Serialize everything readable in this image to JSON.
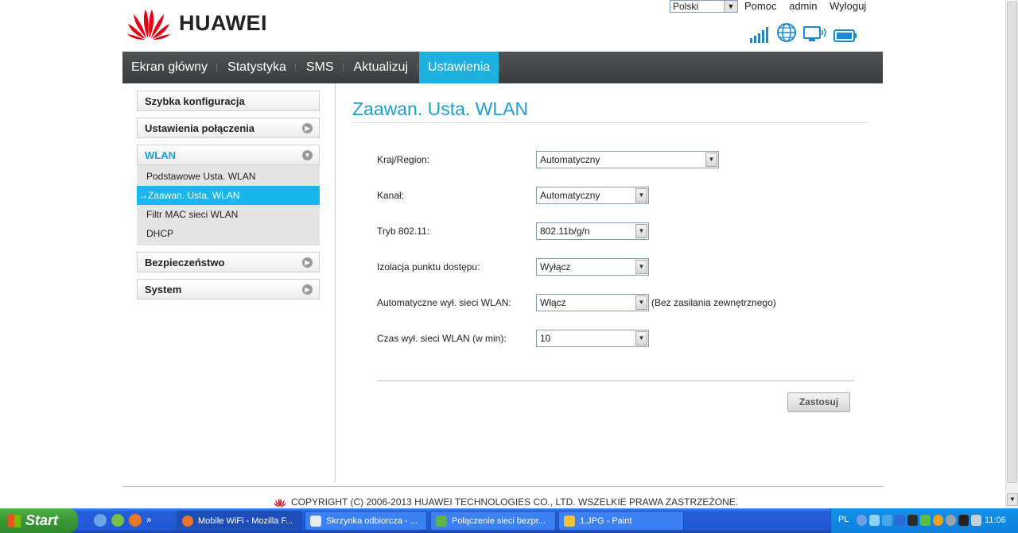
{
  "header": {
    "brand": "HUAWEI",
    "language": "Polski",
    "links": [
      "Pomoc",
      "admin",
      "Wyloguj"
    ],
    "status_icons": [
      "signal-icon",
      "globe-icon",
      "connection-icon",
      "battery-icon"
    ]
  },
  "nav": {
    "items": [
      "Ekran główny",
      "Statystyka",
      "SMS",
      "Aktualizuj",
      "Ustawienia"
    ],
    "active": "Ustawienia"
  },
  "sidebar": {
    "quick": "Szybka konfiguracja",
    "connection": "Ustawienia połączenia",
    "wlan": "WLAN",
    "wlan_items": [
      "Podstawowe Usta. WLAN",
      "Zaawan. Usta. WLAN",
      "Filtr MAC sieci WLAN",
      "DHCP"
    ],
    "selected_item": "→Zaawan. Usta. WLAN",
    "security": "Bezpieczeństwo",
    "system": "System"
  },
  "main": {
    "title": "Zaawan. Usta. WLAN",
    "fields": [
      {
        "label": "Kraj/Region:",
        "value": "Automatyczny"
      },
      {
        "label": "Kanał:",
        "value": "Automatyczny"
      },
      {
        "label": "Tryb 802.11:",
        "value": "802.11b/g/n"
      },
      {
        "label": "Izolacja punktu dostępu:",
        "value": "Wyłącz"
      },
      {
        "label": "Automatyczne wył. sieci WLAN:",
        "value": "Włącz",
        "note": "(Bez zasilania zewnętrznego)"
      },
      {
        "label": "Czas wył. sieci WLAN (w min):",
        "value": "10"
      }
    ],
    "apply": "Zastosuj"
  },
  "footer": {
    "copyright": "COPYRIGHT (C) 2006-2013 HUAWEI TECHNOLOGIES CO., LTD. WSZELKIE PRAWA ZASTRZEŻONE."
  },
  "taskbar": {
    "start": "Start",
    "tasks": [
      "Mobile WiFi - Mozilla F...",
      "Skrzynka odbiorcza - ...",
      "Połączenie sieci bezpr...",
      "1.JPG - Paint"
    ],
    "lang": "PL",
    "clock": "11:06",
    "chevron": "»"
  },
  "colors": {
    "accent": "#1a9fd8",
    "nav_bg": "#3f4344",
    "nav_active": "#1eb0de",
    "logo_red": "#e60012"
  }
}
